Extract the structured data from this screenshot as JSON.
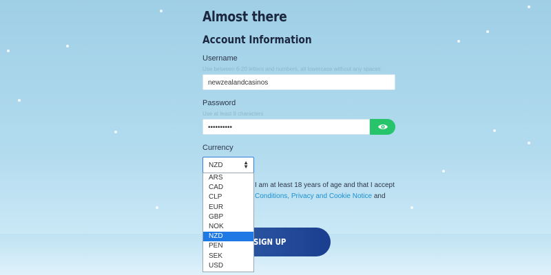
{
  "header": {
    "title": "Almost there",
    "section_title": "Account Information"
  },
  "username": {
    "label": "Username",
    "hint": "Use between 6-20 letters and numbers, all lowercase without any spaces",
    "value": "newzealandcasinos"
  },
  "password": {
    "label": "Password",
    "hint": "Use at least 8 characters",
    "value": "••••••••••",
    "toggle_icon": "eye-icon"
  },
  "currency": {
    "label": "Currency",
    "selected": "NZD",
    "options": [
      "ARS",
      "CAD",
      "CLP",
      "EUR",
      "GBP",
      "NOK",
      "NZD",
      "PEN",
      "SEK",
      "USD"
    ]
  },
  "terms": {
    "line1": "I am at least 18 years of age and that I accept",
    "conditions_link": "Conditions,",
    "privacy_link": "Privacy and Cookie Notice",
    "and_text": "and"
  },
  "signup": {
    "label": "SIGN UP"
  },
  "colors": {
    "accent_green": "#27c46b",
    "select_highlight": "#1f79e5",
    "button_blue": "#1b3e8f"
  }
}
